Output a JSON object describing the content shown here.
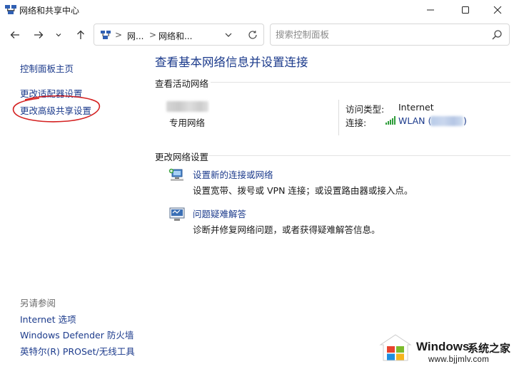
{
  "window": {
    "title": "网络和共享中心",
    "icon": "network-center-icon"
  },
  "addressbar": {
    "segment1": "网...",
    "segment2": "网络和...",
    "separator": ">"
  },
  "search": {
    "placeholder": "搜索控制面板"
  },
  "sidebar": {
    "home": "控制面板主页",
    "adapter": "更改适配器设置",
    "advanced_sharing": "更改高级共享设置",
    "see_also_header": "另请参阅",
    "see_also": [
      "Internet 选项",
      "Windows Defender 防火墙",
      "英特尔(R) PROSet/无线工具"
    ]
  },
  "main": {
    "title": "查看基本网络信息并设置连接",
    "active_networks_label": "查看活动网络",
    "network_type": "专用网络",
    "access_type_label": "访问类型:",
    "access_type_value": "Internet",
    "connection_label": "连接:",
    "connection_value": "WLAN (",
    "connection_close": ")",
    "change_settings_label": "更改网络设置",
    "tasks": [
      {
        "icon": "new-connection-icon",
        "title": "设置新的连接或网络",
        "desc": "设置宽带、拨号或 VPN 连接；或设置路由器或接入点。"
      },
      {
        "icon": "troubleshoot-icon",
        "title": "问题疑难解答",
        "desc": "诊断并修复网络问题，或者获得疑难解答信息。"
      }
    ]
  },
  "watermark": {
    "brand": "Windows",
    "brand_cn": "系统之家",
    "url": "www.bjjmlv.com"
  },
  "colors": {
    "link": "#1c3b8c",
    "annotation_red": "#d42020",
    "signal_green": "#2e9d3a"
  }
}
